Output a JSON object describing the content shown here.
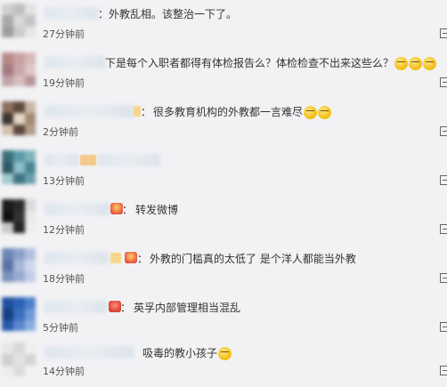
{
  "comments": [
    {
      "text": "外教乱相。该整治一下了。",
      "time": "27分钟前",
      "avatar_colors": [
        "#cfcfcf",
        "#bfbfbf",
        "#e2e2e2",
        "#a9a9a9",
        "#d8d8d8",
        "#c4c4c4",
        "#9d9d9d",
        "#cacaca",
        "#e6e6e6"
      ]
    },
    {
      "text": "下是每个入职者都得有体检报告么？体检检查不出来这些么？",
      "time": "19分钟前",
      "avatar_colors": [
        "#b78a8a",
        "#c9a1a1",
        "#d7b9b9",
        "#a57a80",
        "#caa7aa",
        "#e0c6c6",
        "#c2a3a8",
        "#d7bdbd",
        "#b69499"
      ]
    },
    {
      "text": "很多教育机构的外教都一言难尽",
      "time": "2分钟前",
      "avatar_colors": [
        "#8c6e5a",
        "#5e4a3e",
        "#c9b5a5",
        "#3f3430",
        "#e8d8c8",
        "#a48a74",
        "#d2c0b0",
        "#5a463a",
        "#b09a88"
      ]
    },
    {
      "text": "",
      "time": "13分钟前",
      "avatar_colors": [
        "#3c6f7c",
        "#5d9aa8",
        "#7fb2bd",
        "#2f5b69",
        "#8bbfc7",
        "#4a8594",
        "#a1c9cf",
        "#3e7482",
        "#6aa0ab"
      ]
    },
    {
      "text": "转发微博",
      "time": "12分钟前",
      "avatar_colors": [
        "#1a1a1a",
        "#2a2a2a",
        "#d9d9d9",
        "#101010",
        "#333333",
        "#e9e9e9",
        "#c8c8c8",
        "#242424",
        "#eeeeee"
      ]
    },
    {
      "text": "外教的门槛真的太低了 是个洋人都能当外教",
      "time": "18分钟前",
      "avatar_colors": [
        "#6f86b8",
        "#8aa0c9",
        "#b2bfdd",
        "#5a72a6",
        "#a7b7d8",
        "#cfd8eb",
        "#7c92bf",
        "#98abd1",
        "#c1cde6"
      ]
    },
    {
      "text": "英孚内部管理相当混乱",
      "time": "5分钟前",
      "avatar_colors": [
        "#1f4f9e",
        "#2e63b8",
        "#4d7fcb",
        "#173e82",
        "#3a6fc0",
        "#6f98d8",
        "#275aa9",
        "#5a86cf",
        "#8aaee0"
      ]
    },
    {
      "text": "吸毒的教小孩子",
      "time": "14分钟前",
      "avatar_colors": [
        "#e6e6e6",
        "#d9d9d9",
        "#efefef",
        "#cfcfcf",
        "#e3e3e3",
        "#d4d4d4",
        "#ececec",
        "#dcdcdc",
        "#f2f2f2"
      ]
    }
  ]
}
